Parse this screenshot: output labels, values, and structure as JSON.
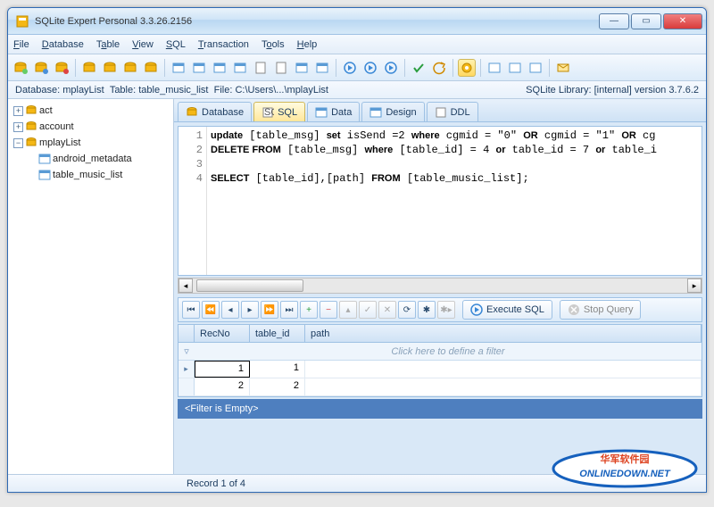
{
  "window": {
    "title": "SQLite Expert Personal 3.3.26.2156"
  },
  "menu": {
    "file": "File",
    "database": "Database",
    "table": "Table",
    "view": "View",
    "sql": "SQL",
    "transaction": "Transaction",
    "tools": "Tools",
    "help": "Help"
  },
  "infobar": {
    "db_label": "Database:",
    "db": "mplayList",
    "tbl_label": "Table:",
    "tbl": "table_music_list",
    "file_label": "File:",
    "file": "C:\\Users\\...\\mplayList",
    "lib": "SQLite Library: [internal] version 3.7.6.2"
  },
  "tree": {
    "items": [
      {
        "exp": "+",
        "name": "act",
        "type": "db"
      },
      {
        "exp": "+",
        "name": "account",
        "type": "db"
      },
      {
        "exp": "-",
        "name": "mplayList",
        "type": "db",
        "children": [
          {
            "name": "android_metadata",
            "type": "table"
          },
          {
            "name": "table_music_list",
            "type": "table"
          }
        ]
      }
    ]
  },
  "tabs": {
    "database": "Database",
    "sql": "SQL",
    "data": "Data",
    "design": "Design",
    "ddl": "DDL"
  },
  "sql": {
    "lines": [
      "update [table_msg] set isSend =2 where cgmid = \"0\" OR cgmid = \"1\" OR cg",
      "DELETE FROM [table_msg] where [table_id] = 4 or table_id = 7 or table_i",
      "",
      "SELECT [table_id],[path] FROM [table_music_list];"
    ]
  },
  "nav": {
    "exec": "Execute SQL",
    "stop": "Stop Query"
  },
  "grid": {
    "cols": [
      "RecNo",
      "table_id",
      "path"
    ],
    "filter_hint": "Click here to define a filter",
    "rows": [
      {
        "recno": "1",
        "table_id": "1",
        "path": ""
      },
      {
        "recno": "2",
        "table_id": "2",
        "path": ""
      }
    ],
    "filter_empty": "<Filter is Empty>"
  },
  "status": {
    "record": "Record 1 of 4"
  },
  "icons": {
    "db": "#f5b815",
    "table": "#5a9bd5",
    "exec": "#3a88d6"
  }
}
